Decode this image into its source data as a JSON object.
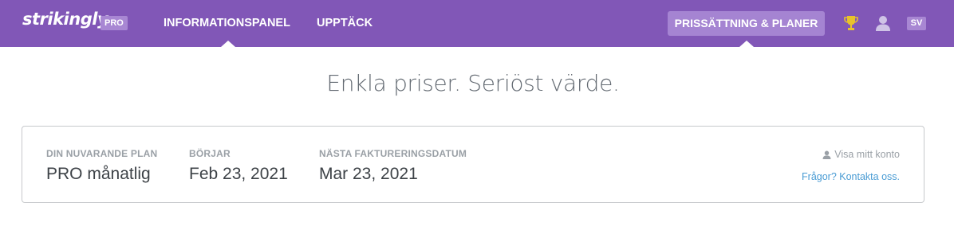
{
  "header": {
    "logo": "strikingly",
    "badge": "PRO",
    "nav": [
      {
        "label": "INFORMATIONSPANEL"
      },
      {
        "label": "UPPTÄCK"
      }
    ],
    "pricing_button": "PRISSÄTTNING & PLANER",
    "language": "SV",
    "icons": [
      "trophy-icon",
      "user-icon"
    ]
  },
  "main": {
    "headline": "Enkla priser. Seriöst värde."
  },
  "plan": {
    "columns": [
      {
        "label": "DIN NUVARANDE PLAN",
        "value": "PRO månatlig"
      },
      {
        "label": "BÖRJAR",
        "value": "Feb 23, 2021"
      },
      {
        "label": "NÄSTA FAKTURERINGSDATUM",
        "value": "Mar 23, 2021"
      }
    ],
    "account_link": "Visa mitt konto",
    "contact_link": "Frågor? Kontakta oss."
  },
  "colors": {
    "brand": "#8157b7",
    "button": "#a584d2",
    "link": "#4a9cd4",
    "trophy": "#e8c22a"
  }
}
